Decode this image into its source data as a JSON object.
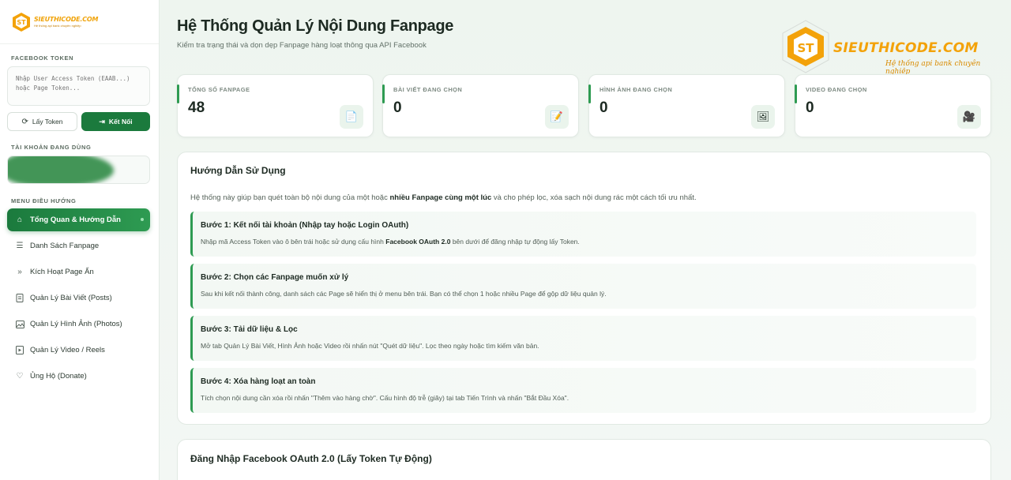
{
  "sidebar": {
    "brand": {
      "title": "SIEUTHICODE.COM",
      "subtitle": "Hệ thống api bank chuyên nghiệp"
    },
    "token_section_label": "FACEBOOK TOKEN",
    "token_placeholder": "Nhập User Access Token (EAAB...) hoặc Page Token...",
    "get_token_label": "Lấy Token",
    "connect_label": "Kết Nối",
    "account_section_label": "TÀI KHOẢN ĐANG DÙNG",
    "menu_label": "MENU ĐIỀU HƯỚNG",
    "items": [
      {
        "label": "Tổng Quan & Hướng Dẫn",
        "icon": "home-icon",
        "active": true
      },
      {
        "label": "Danh Sách Fanpage",
        "icon": "list-icon"
      },
      {
        "label": "Kích Hoạt Page Ẩn",
        "icon": "double-chevron-icon"
      },
      {
        "label": "Quản Lý Bài Viết (Posts)",
        "icon": "document-icon"
      },
      {
        "label": "Quản Lý Hình Ảnh (Photos)",
        "icon": "image-icon"
      },
      {
        "label": "Quản Lý Video / Reels",
        "icon": "video-icon"
      },
      {
        "label": "Ủng Hộ (Donate)",
        "icon": "heart-icon"
      }
    ]
  },
  "header": {
    "title": "Hệ Thống Quản Lý Nội Dung Fanpage",
    "subtitle": "Kiểm tra trạng thái và dọn dẹp Fanpage hàng loạt thông qua API Facebook"
  },
  "brand_banner": {
    "name": "SIEUTHICODE.COM",
    "tagline": "Hệ thống api bank chuyên nghiệp"
  },
  "stats": [
    {
      "label": "TỔNG SỐ FANPAGE",
      "value": "48",
      "icon": "page-icon"
    },
    {
      "label": "BÀI VIẾT ĐANG CHỌN",
      "value": "0",
      "icon": "memo-icon"
    },
    {
      "label": "HÌNH ẢNH ĐANG CHỌN",
      "value": "0",
      "icon": "picture-icon"
    },
    {
      "label": "VIDEO ĐANG CHỌN",
      "value": "0",
      "icon": "camera-icon"
    }
  ],
  "guide": {
    "title": "Hướng Dẫn Sử Dụng",
    "intro_pre": "Hệ thống này giúp bạn quét toàn bộ nội dung của một hoặc",
    "intro_bold": "nhiều Fanpage cùng một lúc",
    "intro_post": "và cho phép lọc, xóa sạch nội dung rác một cách tối ưu nhất.",
    "steps": [
      {
        "title": "Bước 1: Kết nối tài khoản (Nhập tay hoặc Login OAuth)",
        "desc_pre": "Nhập mã Access Token vào ô bên trái hoặc sử dụng cấu hình",
        "desc_bold": "Facebook OAuth 2.0",
        "desc_post": "bên dưới để đăng nhập tự động lấy Token."
      },
      {
        "title": "Bước 2: Chọn các Fanpage muốn xử lý",
        "desc_pre": "Sau khi kết nối thành công, danh sách các Page sẽ hiển thị ở menu bên trái. Bạn có thể chọn 1 hoặc nhiều Page để gộp dữ liệu quản lý.",
        "desc_bold": "",
        "desc_post": ""
      },
      {
        "title": "Bước 3: Tải dữ liệu & Lọc",
        "desc_pre": "Mở tab Quản Lý Bài Viết, Hình Ảnh hoặc Video rồi nhấn nút \"Quét dữ liệu\". Lọc theo ngày hoặc tìm kiếm văn bản.",
        "desc_bold": "",
        "desc_post": ""
      },
      {
        "title": "Bước 4: Xóa hàng loạt an toàn",
        "desc_pre": "Tích chọn nội dung cần xóa rồi nhấn \"Thêm vào hàng chờ\". Cấu hình độ trễ (giây) tại tab Tiến Trình và nhấn \"Bắt Đầu Xóa\".",
        "desc_bold": "",
        "desc_post": ""
      }
    ]
  },
  "oauth": {
    "title": "Đăng Nhập Facebook OAuth 2.0 (Lấy Token Tự Động)"
  },
  "colors": {
    "accent": "#1b7a3d",
    "accent_light": "#2e9b52",
    "brand_orange": "#f3a20a"
  }
}
